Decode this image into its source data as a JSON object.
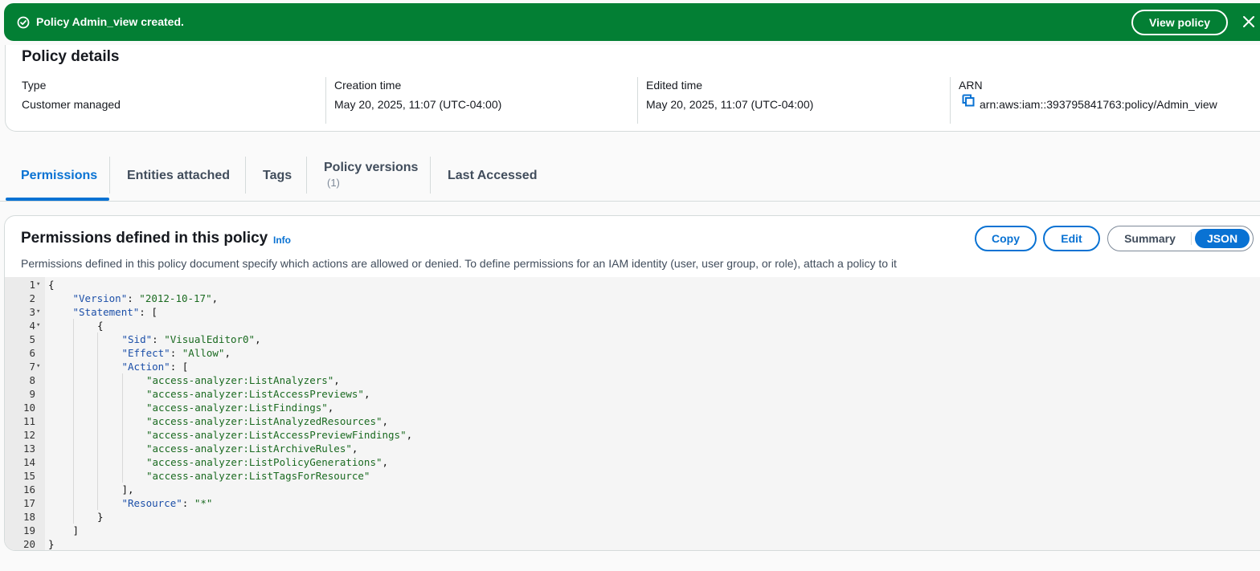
{
  "flash": {
    "message": "Policy Admin_view created.",
    "view_button": "View policy",
    "success_color": "#037f34"
  },
  "details": {
    "title": "Policy details",
    "type_label": "Type",
    "type_value": "Customer managed",
    "creation_label": "Creation time",
    "creation_value": "May 20, 2025, 11:07 (UTC-04:00)",
    "edited_label": "Edited time",
    "edited_value": "May 20, 2025, 11:07 (UTC-04:00)",
    "arn_label": "ARN",
    "arn_value": "arn:aws:iam::393795841763:policy/Admin_view"
  },
  "tabs": {
    "permissions": "Permissions",
    "entities": "Entities attached",
    "tags": "Tags",
    "versions": "Policy versions",
    "versions_count": "(1)",
    "last_accessed": "Last Accessed"
  },
  "permissions": {
    "title": "Permissions defined in this policy",
    "info": "Info",
    "description": "Permissions defined in this policy document specify which actions are allowed or denied. To define permissions for an IAM identity (user, user group, or role), attach a policy to it",
    "copy": "Copy",
    "edit": "Edit",
    "summary": "Summary",
    "json": "JSON",
    "accent_color": "#0972d3"
  },
  "code_lines": [
    {
      "n": "1",
      "fold": true,
      "indent": 0,
      "parts": [
        [
          "p",
          "{"
        ]
      ]
    },
    {
      "n": "2",
      "fold": false,
      "indent": 1,
      "parts": [
        [
          "k",
          "\"Version\""
        ],
        [
          "p",
          ": "
        ],
        [
          "s",
          "\"2012-10-17\""
        ],
        [
          "p",
          ","
        ]
      ]
    },
    {
      "n": "3",
      "fold": true,
      "indent": 1,
      "parts": [
        [
          "k",
          "\"Statement\""
        ],
        [
          "p",
          ": ["
        ]
      ]
    },
    {
      "n": "4",
      "fold": true,
      "indent": 2,
      "parts": [
        [
          "p",
          "{"
        ]
      ]
    },
    {
      "n": "5",
      "fold": false,
      "indent": 3,
      "parts": [
        [
          "k",
          "\"Sid\""
        ],
        [
          "p",
          ": "
        ],
        [
          "s",
          "\"VisualEditor0\""
        ],
        [
          "p",
          ","
        ]
      ]
    },
    {
      "n": "6",
      "fold": false,
      "indent": 3,
      "parts": [
        [
          "k",
          "\"Effect\""
        ],
        [
          "p",
          ": "
        ],
        [
          "s",
          "\"Allow\""
        ],
        [
          "p",
          ","
        ]
      ]
    },
    {
      "n": "7",
      "fold": true,
      "indent": 3,
      "parts": [
        [
          "k",
          "\"Action\""
        ],
        [
          "p",
          ": ["
        ]
      ]
    },
    {
      "n": "8",
      "fold": false,
      "indent": 4,
      "parts": [
        [
          "s",
          "\"access-analyzer:ListAnalyzers\""
        ],
        [
          "p",
          ","
        ]
      ]
    },
    {
      "n": "9",
      "fold": false,
      "indent": 4,
      "parts": [
        [
          "s",
          "\"access-analyzer:ListAccessPreviews\""
        ],
        [
          "p",
          ","
        ]
      ]
    },
    {
      "n": "10",
      "fold": false,
      "indent": 4,
      "parts": [
        [
          "s",
          "\"access-analyzer:ListFindings\""
        ],
        [
          "p",
          ","
        ]
      ]
    },
    {
      "n": "11",
      "fold": false,
      "indent": 4,
      "parts": [
        [
          "s",
          "\"access-analyzer:ListAnalyzedResources\""
        ],
        [
          "p",
          ","
        ]
      ]
    },
    {
      "n": "12",
      "fold": false,
      "indent": 4,
      "parts": [
        [
          "s",
          "\"access-analyzer:ListAccessPreviewFindings\""
        ],
        [
          "p",
          ","
        ]
      ]
    },
    {
      "n": "13",
      "fold": false,
      "indent": 4,
      "parts": [
        [
          "s",
          "\"access-analyzer:ListArchiveRules\""
        ],
        [
          "p",
          ","
        ]
      ]
    },
    {
      "n": "14",
      "fold": false,
      "indent": 4,
      "parts": [
        [
          "s",
          "\"access-analyzer:ListPolicyGenerations\""
        ],
        [
          "p",
          ","
        ]
      ]
    },
    {
      "n": "15",
      "fold": false,
      "indent": 4,
      "parts": [
        [
          "s",
          "\"access-analyzer:ListTagsForResource\""
        ]
      ]
    },
    {
      "n": "16",
      "fold": false,
      "indent": 3,
      "parts": [
        [
          "p",
          "],"
        ]
      ]
    },
    {
      "n": "17",
      "fold": false,
      "indent": 3,
      "parts": [
        [
          "k",
          "\"Resource\""
        ],
        [
          "p",
          ": "
        ],
        [
          "s",
          "\"*\""
        ]
      ]
    },
    {
      "n": "18",
      "fold": false,
      "indent": 2,
      "parts": [
        [
          "p",
          "}"
        ]
      ]
    },
    {
      "n": "19",
      "fold": false,
      "indent": 1,
      "parts": [
        [
          "p",
          "]"
        ]
      ]
    },
    {
      "n": "20",
      "fold": false,
      "indent": 0,
      "parts": [
        [
          "p",
          "}"
        ]
      ]
    }
  ]
}
